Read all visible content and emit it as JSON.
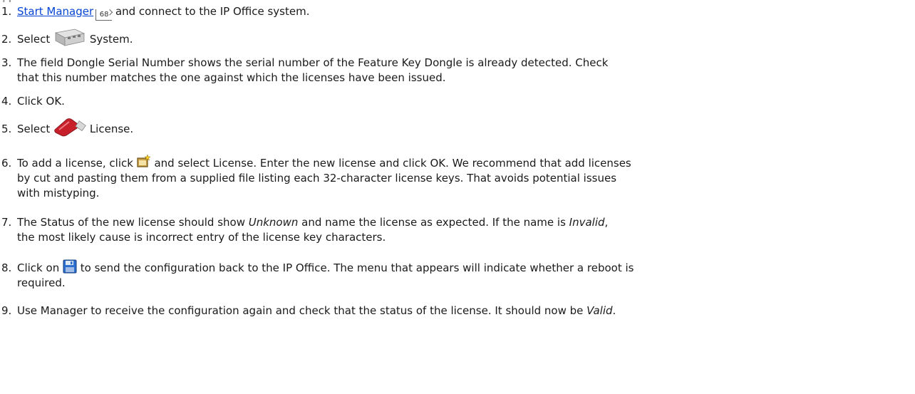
{
  "heading_fragment": "g",
  "steps": [
    {
      "num": "1.",
      "link": "Start Manager",
      "xref": "68",
      "text": " and connect to the IP Office system."
    },
    {
      "num": "2.",
      "pre": "Select ",
      "text": " System.",
      "icon": "system-unit-icon"
    },
    {
      "num": "3.",
      "text": "The field Dongle Serial Number shows the serial number of the Feature Key Dongle is already detected. Check",
      "cont": "that this number matches the one against which the licenses have been issued."
    },
    {
      "num": "4.",
      "text": "Click OK."
    },
    {
      "num": "5.",
      "pre": "Select ",
      "text": " License.",
      "icon": "license-key-icon"
    },
    {
      "num": "6.",
      "pre": "To add a license, click ",
      "text": " and select License. Enter the new license and click OK. We recommend that add licenses",
      "icon": "new-record-icon",
      "cont1": "by cut and pasting them   from a supplied file listing each 32-character license keys. That avoids potential issues",
      "cont2": "with mistyping."
    },
    {
      "num": "7.",
      "pre": "The Status of the new license should show ",
      "em1": "Unknown",
      "mid": " and name the license as expected. If the name is ",
      "em2": "Invalid",
      "post": ",",
      "cont": "the most likely cause is incorrect entry of the license key characters."
    },
    {
      "num": "8.",
      "pre": "Click on ",
      "text": " to send the configuration back to the IP Office. The menu that appears will indicate whether a reboot is",
      "icon": "save-icon",
      "cont": "required."
    },
    {
      "num": "9.",
      "text": "Use Manager to receive the configuration again and check that the status of the license. It should now be ",
      "em": "Valid",
      "post": "."
    }
  ],
  "colors": {
    "link": "#0645d4",
    "text": "#1a1a1a",
    "license_red": "#c8202a",
    "save_blue": "#2f6fd0"
  }
}
